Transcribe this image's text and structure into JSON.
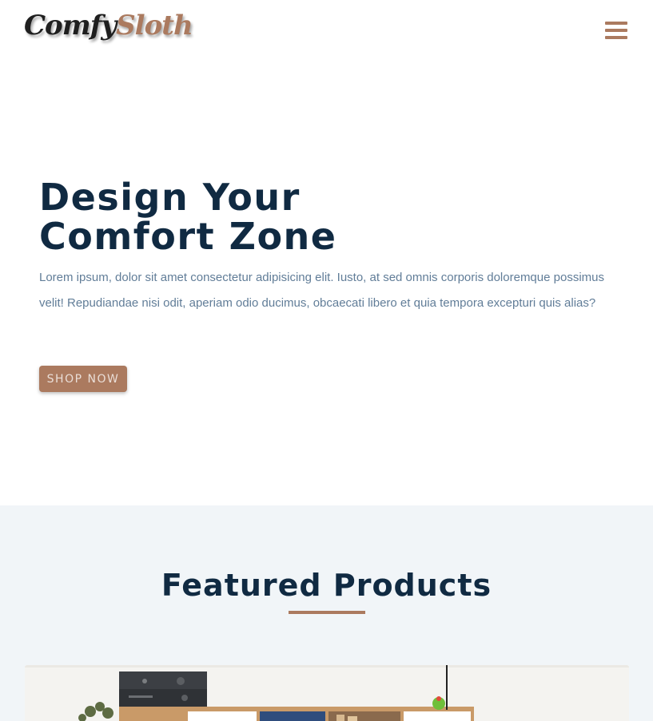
{
  "brand": {
    "name_part1": "Comfy",
    "name_part2": "Sloth"
  },
  "nav": {
    "menu_icon": "hamburger-menu-icon"
  },
  "hero": {
    "title_line1": "Design Your",
    "title_line2": "Comfort Zone",
    "text": "Lorem ipsum, dolor sit amet consectetur adipisicing elit. Iusto, at sed omnis corporis doloremque possimus velit! Repudiandae nisi odit, aperiam odio ducimus, obcaecati libero et quia tempora excepturi quis alias?",
    "cta_label": "SHOP NOW"
  },
  "featured": {
    "title": "Featured Products",
    "products": [
      {
        "image": "furniture-shelf-image"
      }
    ]
  },
  "colors": {
    "primary": "#ab7a5f",
    "heading": "#102a42",
    "body_text": "#617d98",
    "section_bg": "#f1f5f8",
    "background": "#ffffff"
  }
}
